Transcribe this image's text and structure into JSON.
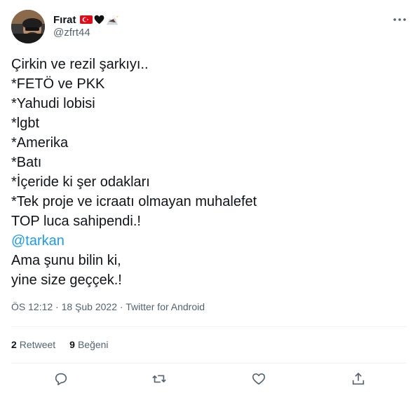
{
  "author": {
    "display_name": "Fırat",
    "handle": "@zfrt44",
    "badge_emojis": [
      "flag-turkey-icon",
      "black-heart-icon",
      "eagle-icon"
    ]
  },
  "tweet": {
    "lines": [
      "Çirkin ve rezil şarkıyı..",
      "*FETÖ ve PKK",
      "*Yahudi lobisi",
      "*lgbt",
      "*Amerika",
      "*Batı",
      "*İçeride ki şer odakları",
      "*Tek proje ve icraatı olmayan muhalefet",
      "TOP luca sahipendi.!"
    ],
    "mention": "@tarkan",
    "lines_after": [
      "Ama şunu bilin ki,",
      "yine size geççek.!"
    ],
    "meta": "ÖS 12:12 · 18 Şub 2022 · Twitter for Android"
  },
  "stats": {
    "retweets_count": "2",
    "retweets_label": "Retweet",
    "likes_count": "9",
    "likes_label": "Beğeni"
  },
  "colors": {
    "text": "#0f1419",
    "secondary": "#536471",
    "link": "#1d9bf0",
    "divider": "#eff3f4"
  }
}
